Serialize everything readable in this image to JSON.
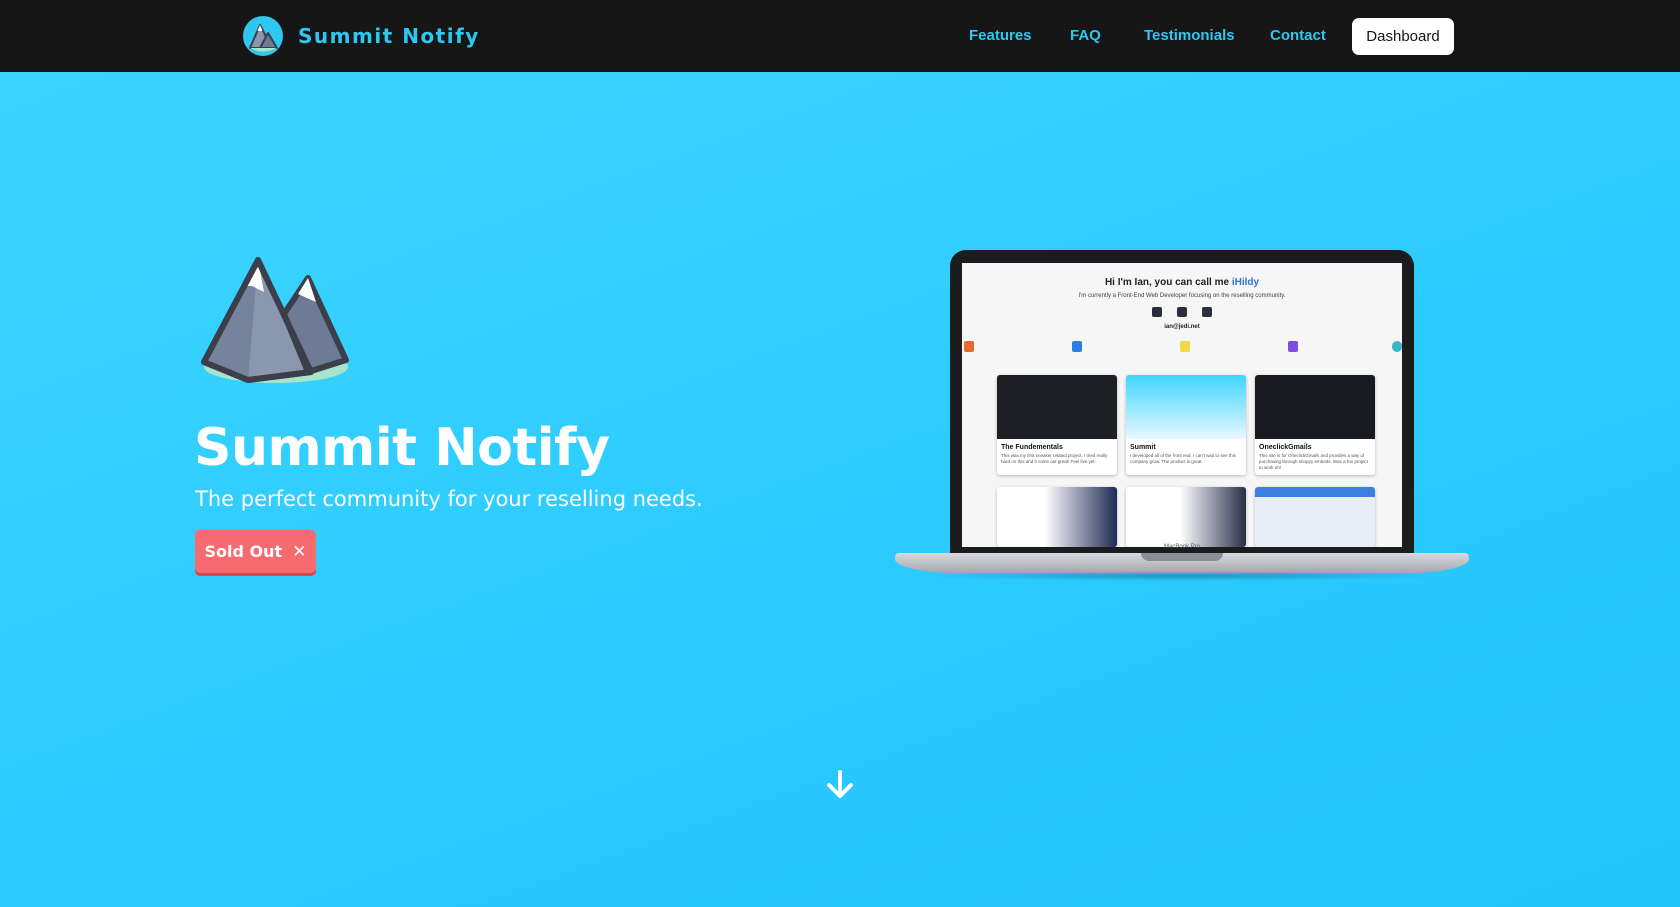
{
  "nav": {
    "brand": "Summit Notify",
    "links": [
      {
        "label": "Features",
        "name": "nav-link-features"
      },
      {
        "label": "FAQ",
        "name": "nav-link-faq"
      },
      {
        "label": "Testimonials",
        "name": "nav-link-testimonials"
      },
      {
        "label": "Contact",
        "name": "nav-link-contact"
      }
    ],
    "dashboard_label": "Dashboard"
  },
  "hero": {
    "title": "Summit Notify",
    "subtitle": "The perfect community for your reselling needs.",
    "sold_out_label": "Sold Out",
    "sold_out_icon": "close-icon",
    "scroll_icon": "arrow-down-icon"
  },
  "laptop": {
    "greeting_prefix": "Hi I'm Ian, you can call me ",
    "greeting_name": "iHildy",
    "description": "I'm currently a Front-End Web Developer focusing on the reselling community.",
    "email": "ian@jedi.net",
    "socials": [
      "twitter-icon",
      "github-icon",
      "discord-icon"
    ],
    "tech_icons": [
      "html5-icon",
      "css3-icon",
      "javascript-icon",
      "bootstrap-icon",
      "tailwind-icon"
    ],
    "model_label": "MacBook Pro",
    "cards": [
      {
        "title": "The Fundementals",
        "text": "This was my first sneaker related project. I tried really hard on this and it came out great! Feel live yet."
      },
      {
        "title": "Summit",
        "text": "I developed all of the front end. I can't wait to see this company grow. The product is great."
      },
      {
        "title": "OneclickGmails",
        "text": "This site is for OneclickGmails and provides a way of purchasing through shoppy embeds. Was a fun project to work on!"
      }
    ]
  },
  "colors": {
    "background": "#2ccbff",
    "nav_background": "#161616",
    "accent": "#2ec7f0",
    "sold_out": "#f76a70"
  }
}
